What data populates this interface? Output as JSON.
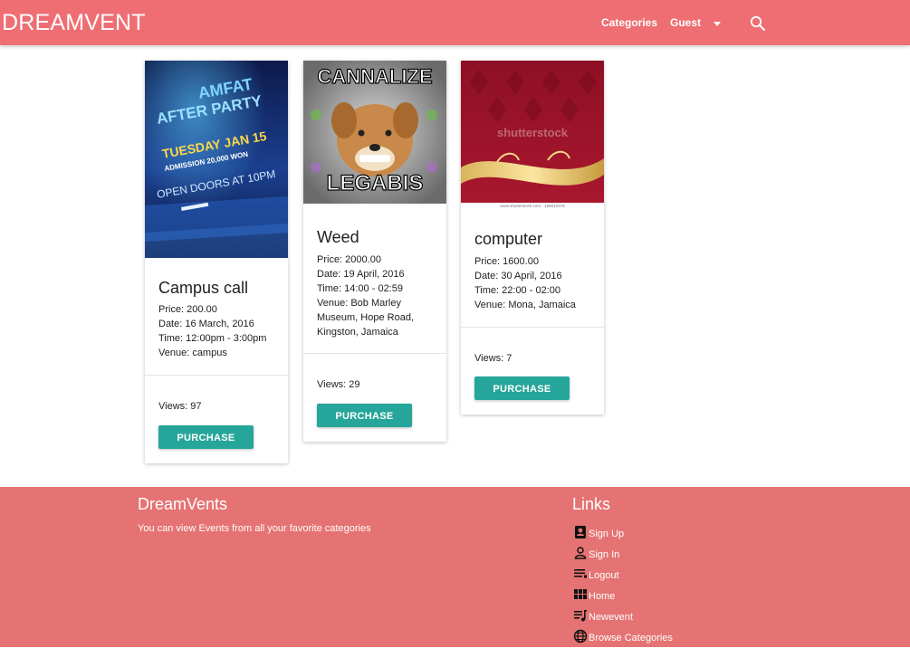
{
  "navbar": {
    "brand": "DREAMVENT",
    "categories_label": "Categories",
    "user_label": "Guest",
    "search_icon": "search-icon"
  },
  "events": [
    {
      "title": "Campus call",
      "image_text": [
        "AMFAT",
        "AFTER PARTY",
        "TUESDAY JAN 15",
        "ADMISSION 20,000 WON",
        "OPEN DOORS AT 10PM"
      ],
      "info": [
        "Price: 200.00",
        "Date: 16 March, 2016",
        "Time: 12:00pm - 3:00pm",
        "Venue: campus"
      ],
      "views": "Views: 97",
      "button": "PURCHASE"
    },
    {
      "title": "Weed",
      "image_text": [
        "CANNALIZE",
        "LEGABIS"
      ],
      "info": [
        "Price: 2000.00",
        "Date: 19 April, 2016",
        "Time: 14:00 - 02:59",
        "Venue: Bob Marley Museum, Hope Road, Kingston, Jamaica"
      ],
      "views": "Views: 29",
      "button": "PURCHASE"
    },
    {
      "title": "computer",
      "image_text": [
        "shutterstock",
        "www.shutterstock.com · 168810378"
      ],
      "info": [
        "Price: 1600.00",
        "Date: 30 April, 2016",
        "Time: 22:00 - 02:00",
        "Venue: Mona, Jamaica"
      ],
      "views": "Views: 7",
      "button": "PURCHASE"
    }
  ],
  "footer": {
    "title": "DreamVents",
    "text": "You can view Events from all your favorite categories",
    "links_title": "Links",
    "links": [
      {
        "label": "Sign Up",
        "icon": "contact-card-icon"
      },
      {
        "label": "Sign In",
        "icon": "person-icon"
      },
      {
        "label": "Logout",
        "icon": "list-icon"
      },
      {
        "label": "Home",
        "icon": "grid-icon"
      },
      {
        "label": "Newevent",
        "icon": "playlist-icon"
      },
      {
        "label": "Browse Categories",
        "icon": "globe-icon"
      }
    ]
  },
  "colors": {
    "navbar": "#ee6e73",
    "footer": "#e57373",
    "button": "#26a69a"
  }
}
